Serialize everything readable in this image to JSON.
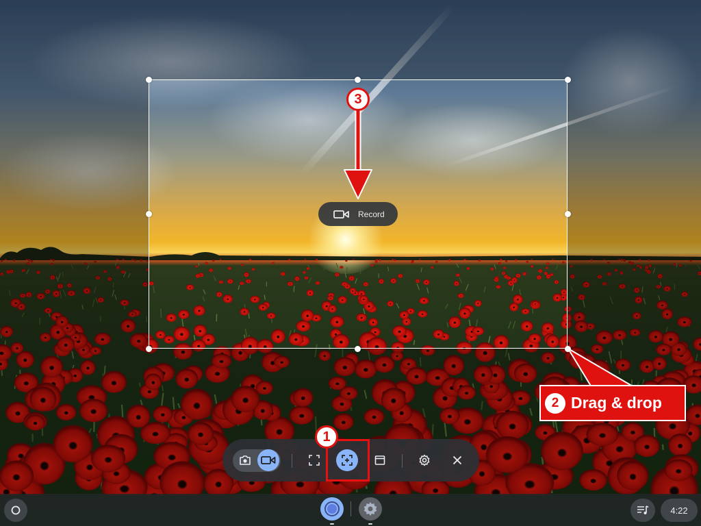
{
  "capture_region": {
    "record_button_label": "Record",
    "record_icon": "video-camera-icon"
  },
  "capture_bar": {
    "mode_toggle": [
      {
        "name": "screenshot-mode",
        "icon": "camera-icon",
        "active": false
      },
      {
        "name": "video-mode",
        "icon": "video-camera-icon",
        "active": true
      }
    ],
    "source_options": [
      {
        "name": "fullscreen",
        "icon": "fullscreen-icon",
        "active": false
      },
      {
        "name": "partial",
        "icon": "partial-select-icon",
        "active": true
      },
      {
        "name": "window",
        "icon": "window-icon",
        "active": false
      }
    ],
    "settings_icon": "gear-icon",
    "close_icon": "close-icon"
  },
  "annotations": {
    "step1": "1",
    "step2": "2",
    "step2_label": "Drag & drop",
    "step3": "3",
    "color": "#e0120f"
  },
  "shelf": {
    "launcher_icon": "launcher-circle-icon",
    "apps": [
      {
        "name": "chrome",
        "icon": "chrome-icon"
      },
      {
        "name": "settings",
        "icon": "settings-gear-icon"
      }
    ],
    "media_icon": "playlist-icon",
    "time": "4:22"
  }
}
